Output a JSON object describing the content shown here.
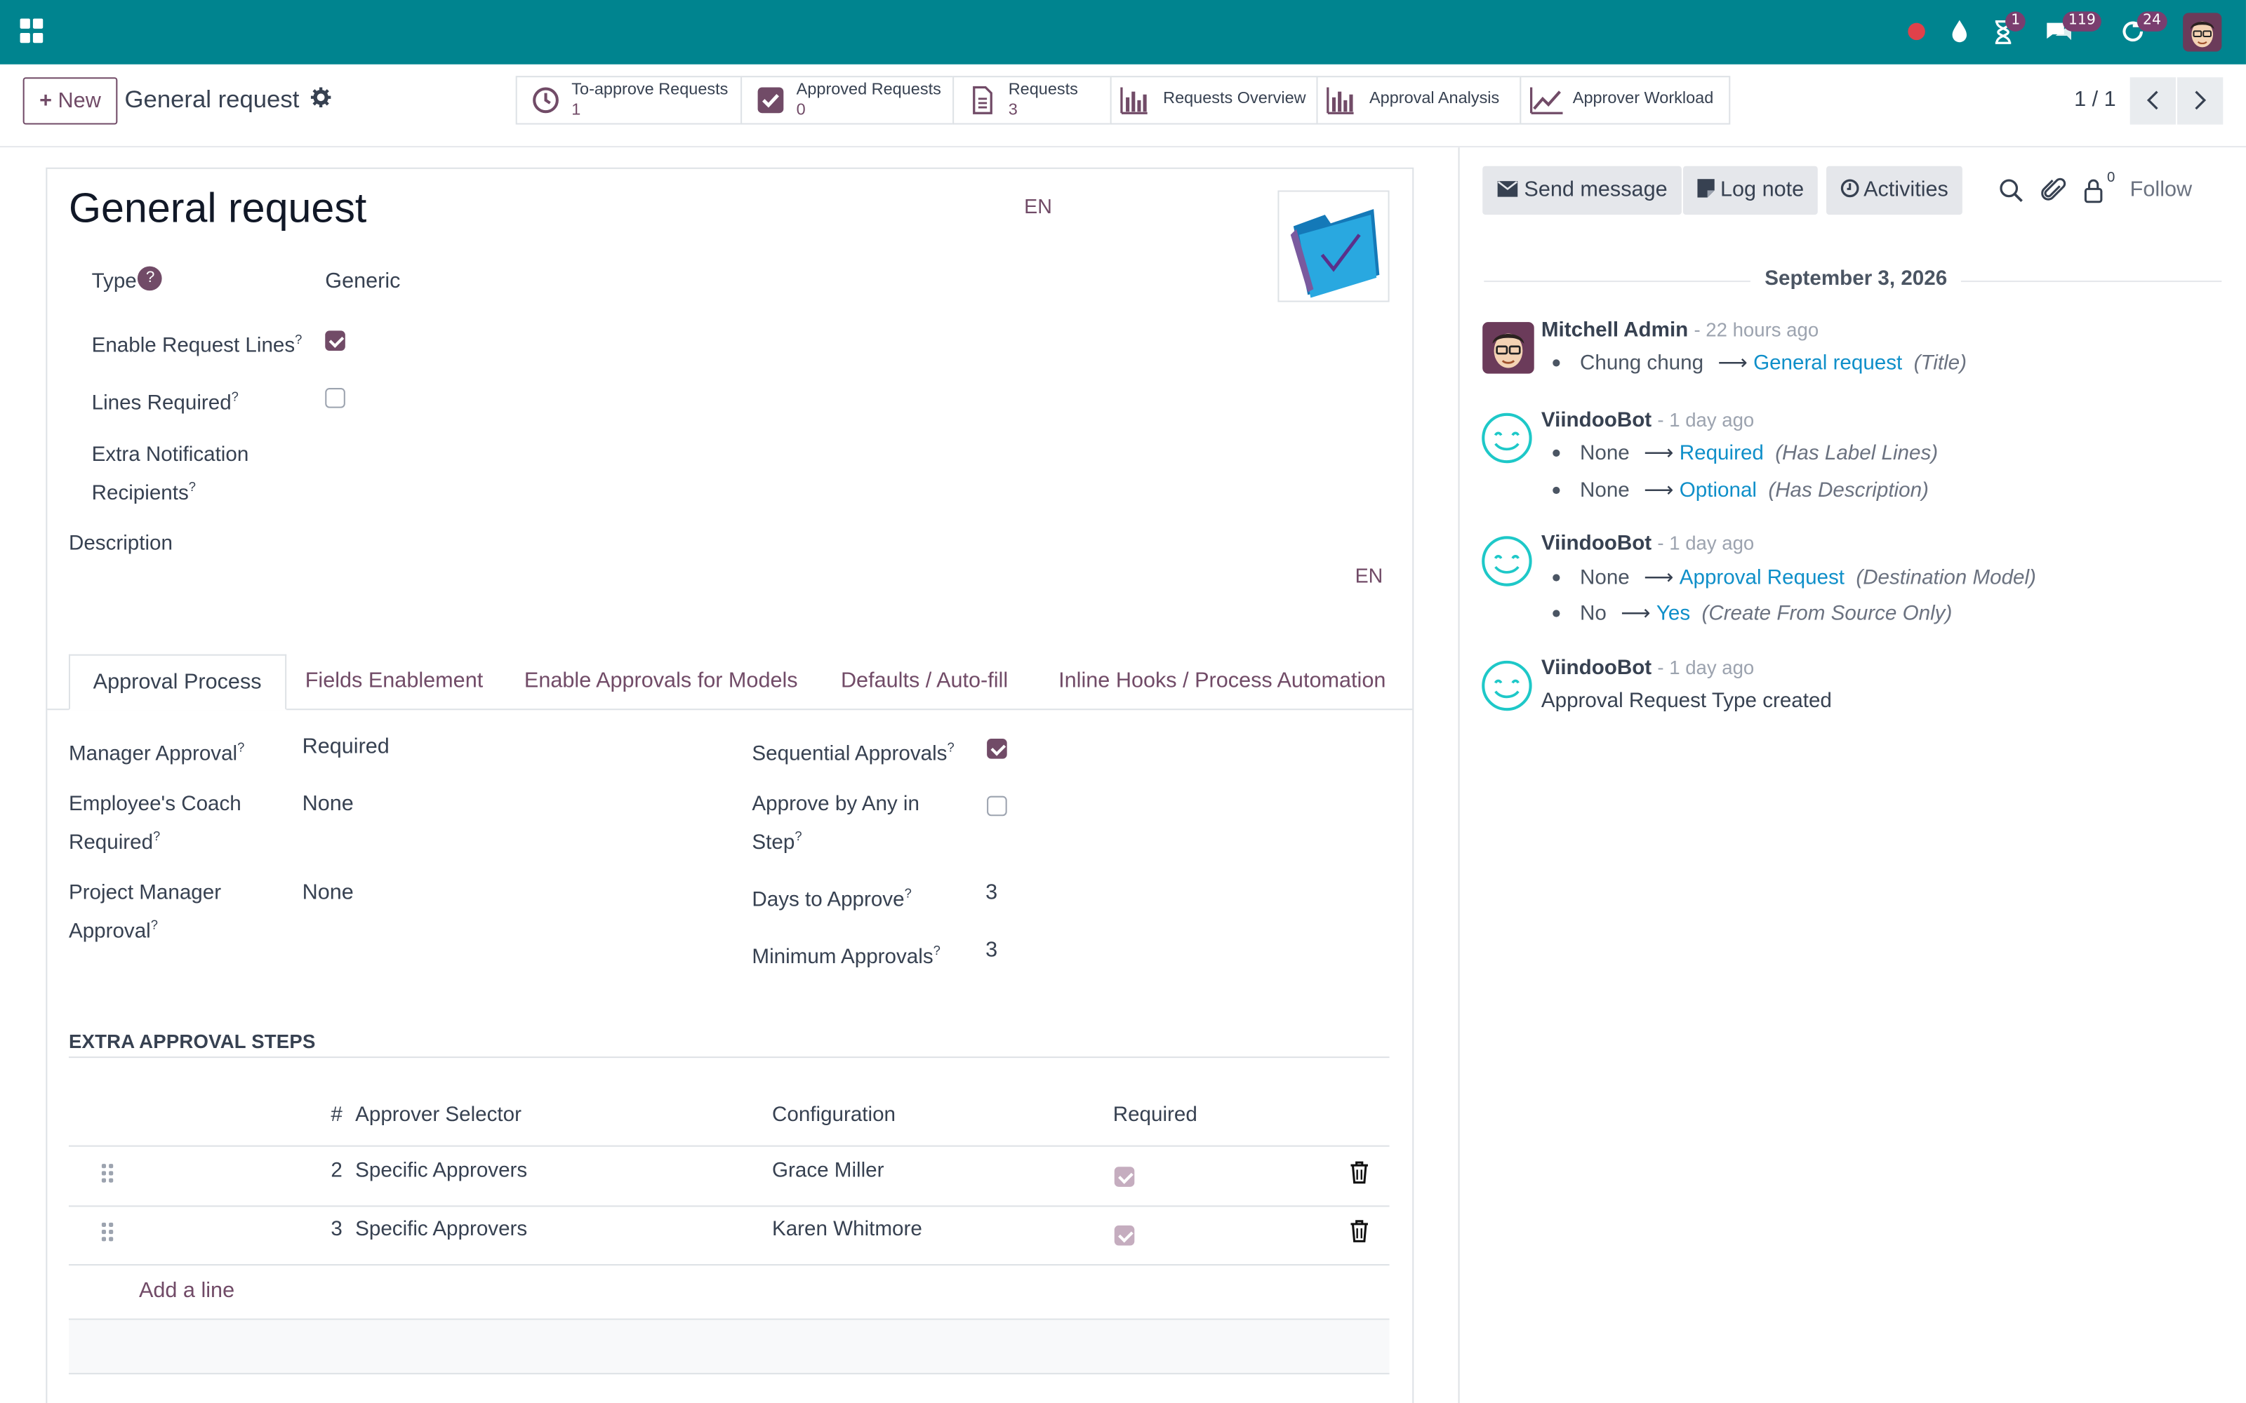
{
  "navbar": {
    "notifications": {
      "activities_count": "1",
      "messages_count": "119",
      "updates_count": "24"
    }
  },
  "control": {
    "new_label": "New",
    "breadcrumb_title": "General request",
    "smart_buttons": [
      {
        "label": "To-approve Requests",
        "value": "1",
        "icon": "clock-icon"
      },
      {
        "label": "Approved Requests",
        "value": "0",
        "icon": "checkbox-icon"
      },
      {
        "label": "Requests",
        "value": "3",
        "icon": "document-icon"
      },
      {
        "label": "Requests Overview",
        "icon": "bar-chart-icon"
      },
      {
        "label": "Approval Analysis",
        "icon": "bar-chart-icon"
      },
      {
        "label": "Approver Workload",
        "icon": "line-chart-icon"
      }
    ],
    "pager": "1 / 1"
  },
  "form": {
    "title": "General request",
    "lang_badge": "EN",
    "type_label": "Type",
    "type_help": "?",
    "type_value": "Generic",
    "enable_request_lines_label": "Enable Request Lines",
    "enable_request_lines": true,
    "lines_required_label": "Lines Required",
    "lines_required": false,
    "extra_recipients_label_1": "Extra Notification",
    "extra_recipients_label_2": "Recipients",
    "description_label": "Description",
    "description_lang": "EN",
    "help_mark": "?"
  },
  "tabs": [
    {
      "label": "Approval Process",
      "active": true
    },
    {
      "label": "Fields Enablement",
      "active": false
    },
    {
      "label": "Enable Approvals for Models",
      "active": false
    },
    {
      "label": "Defaults / Auto-fill",
      "active": false
    },
    {
      "label": "Inline Hooks / Process Automation",
      "active": false
    }
  ],
  "approval": {
    "manager_label": "Manager Approval",
    "manager_value": "Required",
    "coach_label_1": "Employee's Coach",
    "coach_label_2": "Required",
    "coach_value": "None",
    "pm_label_1": "Project Manager",
    "pm_label_2": "Approval",
    "pm_value": "None",
    "sequential_label": "Sequential Approvals",
    "sequential": true,
    "any_label_1": "Approve by Any in",
    "any_label_2": "Step",
    "any_in_step": false,
    "days_label": "Days to Approve",
    "days_value": "3",
    "min_label": "Minimum Approvals",
    "min_value": "3"
  },
  "extra_steps": {
    "section_title": "EXTRA APPROVAL STEPS",
    "headers": {
      "num": "#",
      "selector": "Approver Selector",
      "config": "Configuration",
      "required": "Required"
    },
    "rows": [
      {
        "num": "2",
        "selector": "Specific Approvers",
        "config": "Grace Miller",
        "required": true
      },
      {
        "num": "3",
        "selector": "Specific Approvers",
        "config": "Karen Whitmore",
        "required": true
      }
    ],
    "add_line": "Add a line"
  },
  "chatter": {
    "send_message": "Send message",
    "log_note": "Log note",
    "activities": "Activities",
    "followers_count": "0",
    "follow": "Follow",
    "date": "September 3, 2026",
    "messages": [
      {
        "author": "Mitchell Admin",
        "when": "- 22 hours ago",
        "tracks": [
          {
            "old": "Chung chung",
            "new": "General request",
            "field": "(Title)"
          }
        ]
      },
      {
        "author": "ViindooBot",
        "when": "- 1 day ago",
        "tracks": [
          {
            "old": "None",
            "new": "Required",
            "field": "(Has Label Lines)"
          },
          {
            "old": "None",
            "new": "Optional",
            "field": "(Has Description)"
          }
        ]
      },
      {
        "author": "ViindooBot",
        "when": "- 1 day ago",
        "tracks": [
          {
            "old": "None",
            "new": "Approval Request",
            "field": "(Destination Model)"
          },
          {
            "old": "No",
            "new": "Yes",
            "field": "(Create From Source Only)"
          }
        ]
      },
      {
        "author": "ViindooBot",
        "when": "- 1 day ago",
        "body": "Approval Request Type created"
      }
    ]
  }
}
